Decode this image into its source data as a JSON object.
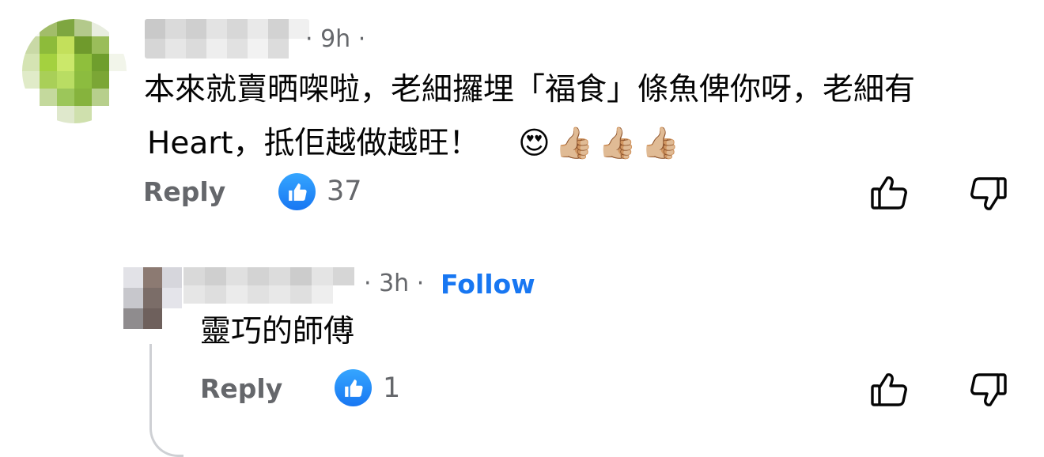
{
  "comment1": {
    "avatar_colors": [
      "#f4f6f1",
      "#a2bd6a",
      "#7ea640",
      "#b3c98b",
      "#e8eddf",
      "#ffffff",
      "#c9d9a6",
      "#8dbb3a",
      "#c3e05b",
      "#6f9a2c",
      "#9abd5a",
      "#ffffff",
      "#d5e4b3",
      "#a4d13f",
      "#cbe86a",
      "#8fbf3c",
      "#6f9e2d",
      "#f2f5ea",
      "#e0ebc8",
      "#a9cf58",
      "#b9dd63",
      "#8cbc3f",
      "#7ba635",
      "#ffffff",
      "#ffffff",
      "#c4d99d",
      "#9cc65a",
      "#86b33d",
      "#b7cf8c",
      "#ffffff",
      "#ffffff",
      "#ffffff",
      "#dfe8cc",
      "#cfe0ad",
      "#ffffff",
      "#ffffff"
    ],
    "name_colors": [
      "#c9c9c9",
      "#dadada",
      "#cfcfcf",
      "#e3e3e3",
      "#d7d7d7",
      "#e9e9e9",
      "#d2d2d2",
      "#f0f0f0",
      "#d6d6d6",
      "#e6e6e6",
      "#dbdbdb",
      "#eeeeee",
      "#e1e1e1",
      "#f2f2f2",
      "#dcdcdc",
      "#ffffff"
    ],
    "time": "· 9h ·",
    "text_line1": "本來就賣晒㗎啦，老細攞埋「福食」條魚俾你呀，老細有",
    "text_line2": "Heart，抵佢越做越旺！",
    "emojis": "😍👍🏼👍🏼👍🏼",
    "reply_label": "Reply",
    "like_count": "37"
  },
  "comment2": {
    "avatar_colors": [
      "#e2e2e7",
      "#8c7a72",
      "#d6d6dc",
      "#c7c7cc",
      "#7b6d68",
      "#e4e4ea",
      "#8f8c8e",
      "#6e605c",
      "#ffffff"
    ],
    "name_colors": [
      "#d9d9d9",
      "#cfcfcf",
      "#e0e0e0",
      "#d3d3d3",
      "#dcdcdc",
      "#cccccc",
      "#e4e4e4",
      "#d6d6d6",
      "#e6e6e6",
      "#dedede",
      "#ebebeb",
      "#e1e1e1",
      "#e8e8e8",
      "#dfdfdf",
      "#eeeeee",
      "#ffffff"
    ],
    "time": "· 3h ·",
    "follow_label": "Follow",
    "text": "靈巧的師傅",
    "reply_label": "Reply",
    "like_count": "1"
  },
  "colors": {
    "accent": "#1877f2",
    "muted": "#65676b",
    "text": "#050505"
  }
}
